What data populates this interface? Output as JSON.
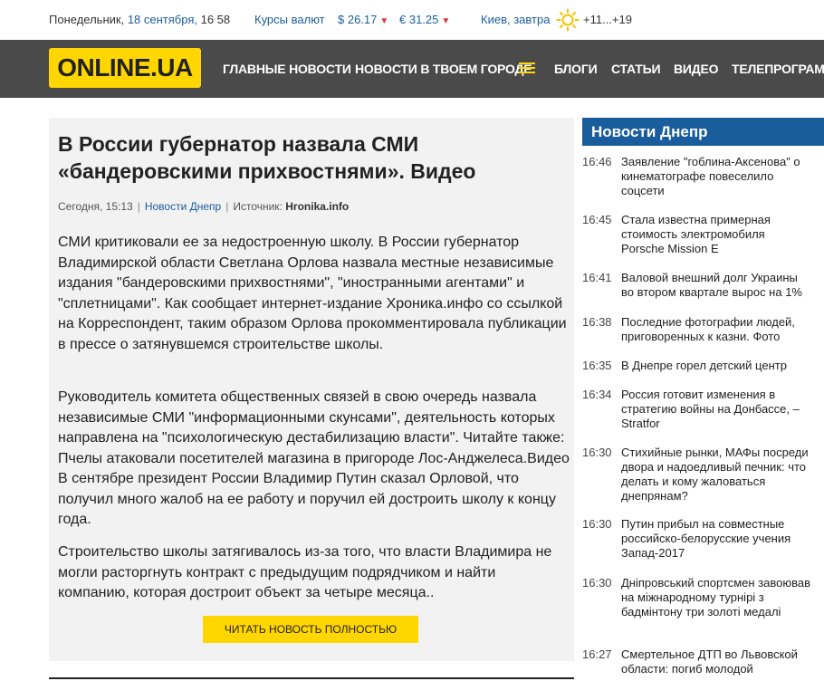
{
  "topbar": {
    "day": "Понедельник,",
    "date": "18 сентября,",
    "time": "16 58",
    "rates_label": "Курсы валют",
    "usd": "$ 26.17",
    "eur": "€ 31.25",
    "arrow": "▼",
    "city": "Киев, завтра",
    "temp": "+11...+19"
  },
  "nav": {
    "logo": "ONLINE.UA",
    "items": [
      "Главные новости",
      "Новости в твоем городе",
      "Блоги",
      "Статьи",
      "Видео",
      "Телепрограмма"
    ]
  },
  "article": {
    "title": "В России губернатор назвала СМИ «бандеровскими прихвостнями». Видео",
    "date": "Сегодня, 15:13",
    "category": "Новости Днепр",
    "source_label": "Источник:",
    "source": "Hronika.info",
    "p1": "СМИ критиковали ее за недостроенную школу. В России губернатор Владимирской области Светлана Орлова назвала местные независимые издания \"бандеровскими прихвостнями\", \"иностранными агентами\" и \"сплетницами\". Как сообщает интернет-издание Хроника.инфо со ссылкой на Корреспондент, таким образом Орлова прокомментировала публикации в прессе о затянувшемся строительстве школы.",
    "p2": "Руководитель комитета общественных связей в свою очередь назвала независимые СМИ \"информационными скунсами\", деятельность которых направлена на \"психологическую дестабилизацию власти\". Читайте также: Пчелы атаковали посетителей магазина в пригороде Лос-Анджелеса.Видео В сентябре президент России Владимир Путин сказал Орловой, что получил много жалоб на ее работу и поручил ей достроить школу к концу года.",
    "p3": "Строительство школы затягивалось из-за того, что власти Владимира не могли расторгнуть контракт с предыдущим подрядчиком и найти компанию, которая достроит объект за четыре месяца..",
    "read_more": "Читать новость полностью"
  },
  "sidebar": {
    "title": "Новости Днепр",
    "items": [
      {
        "time": "16:46",
        "text": "Заявление \"гоблина-Аксенова\" о кинематографе повеселило соцсети"
      },
      {
        "time": "16:45",
        "text": "Стала известна примерная стоимость электромобиля Porsche Mission E"
      },
      {
        "time": "16:41",
        "text": "Валовой внешний долг Украины во втором квартале вырос на 1%"
      },
      {
        "time": "16:38",
        "text": "Последние фотографии людей, приговоренных к казни. Фото"
      },
      {
        "time": "16:35",
        "text": "В Днепре горел детский центр"
      },
      {
        "time": "16:34",
        "text": "Россия готовит изменения в стратегию войны на Донбассе, – Stratfor"
      },
      {
        "time": "16:30",
        "text": "Стихийные рынки, МАФы посреди двора и надоедливый печник: что делать и кому жаловаться днепрянам?"
      },
      {
        "time": "16:30",
        "text": "Путин прибыл на совместные российско-белорусские учения Запад-2017"
      },
      {
        "time": "16:30",
        "text": "Дніпровський спортсмен завоював на міжнародному турнірі з бадмінтону три золоті медалі"
      },
      {
        "time": "16:27",
        "text": "Смертельное ДТП во Львовской области: погиб молодой мотоциклист"
      }
    ]
  },
  "colors": {
    "accent": "#ffd600",
    "nav_bg": "#4a4a4a",
    "link": "#1a5d9c"
  }
}
